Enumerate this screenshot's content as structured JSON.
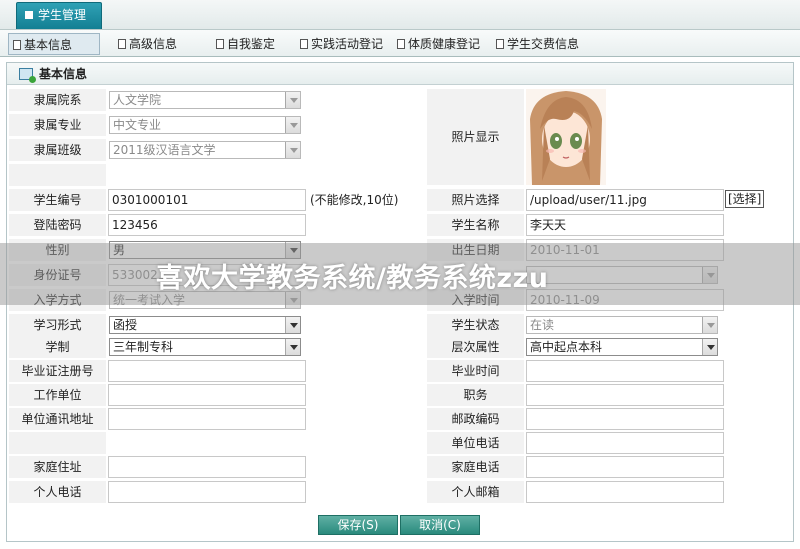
{
  "top_tab": {
    "label": "学生管理"
  },
  "subnav": [
    {
      "label": "基本信息"
    },
    {
      "label": "高级信息"
    },
    {
      "label": "自我鉴定"
    },
    {
      "label": "实践活动登记"
    },
    {
      "label": "体质健康登记"
    },
    {
      "label": "学生交费信息"
    }
  ],
  "section_title": "基本信息",
  "left": {
    "college_label": "隶属院系",
    "college_value": "人文学院",
    "major_label": "隶属专业",
    "major_value": "中文专业",
    "class_label": "隶属班级",
    "class_value": "2011级汉语言文学",
    "student_no_label": "学生编号",
    "student_no_value": "0301000101",
    "student_no_hint": "(不能修改,10位)",
    "password_label": "登陆密码",
    "password_value": "123456",
    "gender_label": "性别",
    "gender_value": "男",
    "id_label": "身份证号",
    "id_value": "5330021",
    "admission_label": "入学方式",
    "admission_value": "统一考试入学",
    "study_form_label": "学习形式",
    "study_form_value": "函授",
    "duration_label": "学制",
    "duration_value": "三年制专科",
    "diploma_label": "毕业证注册号",
    "work_unit_label": "工作单位",
    "unit_address_label": "单位通讯地址",
    "home_address_label": "家庭住址",
    "personal_phone_label": "个人电话"
  },
  "right": {
    "photo_label": "照片显示",
    "photo_select_label": "照片选择",
    "photo_path": "/upload/user/11.jpg",
    "choose_button": "[选择]",
    "name_label": "学生名称",
    "name_value": "李天天",
    "birth_label": "出生日期",
    "birth_value": "2010-11-01",
    "enroll_label": "入学时间",
    "enroll_value": "2010-11-09",
    "status_label": "学生状态",
    "status_value": "在读",
    "level_label": "层次属性",
    "level_value": "高中起点本科",
    "grad_time_label": "毕业时间",
    "position_label": "职务",
    "postcode_label": "邮政编码",
    "unit_phone_label": "单位电话",
    "home_phone_label": "家庭电话",
    "email_label": "个人邮箱"
  },
  "buttons": {
    "save": "保存(S)",
    "cancel": "取消(C)"
  },
  "watermark": "喜欢大学教务系统/教务系统zzu",
  "colors": {
    "tab_accent": "#1a8ca0",
    "button": "#2f8f82"
  }
}
